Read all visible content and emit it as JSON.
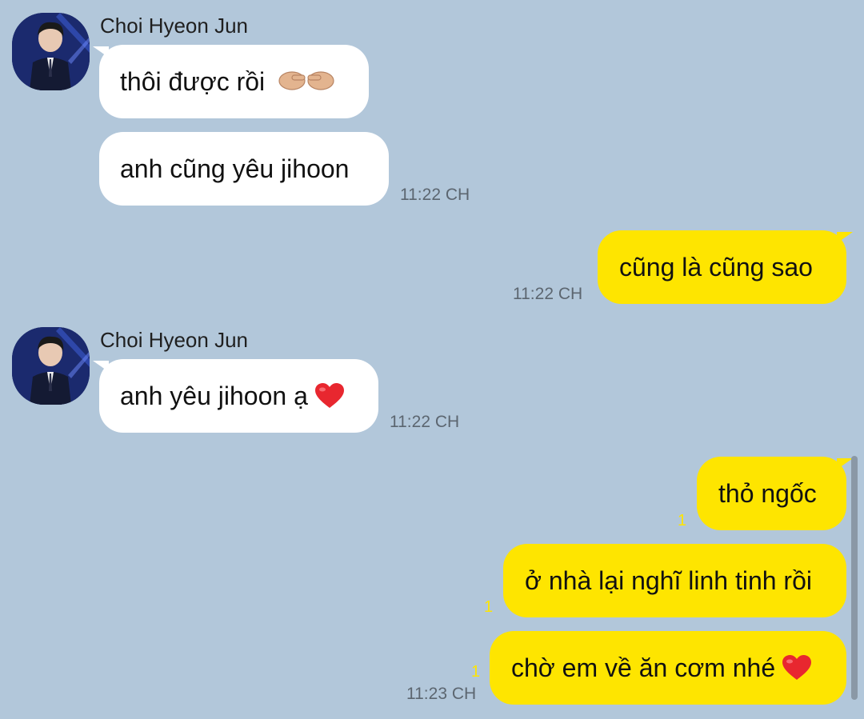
{
  "messages": {
    "m1": {
      "sender": "Choi Hyeon Jun",
      "text": "thôi được rồi",
      "emoji": "pointing-hands"
    },
    "m2": {
      "text": "anh cũng yêu jihoon",
      "time": "11:22 CH"
    },
    "m3": {
      "text": "cũng là cũng sao",
      "time": "11:22 CH"
    },
    "m4": {
      "sender": "Choi Hyeon Jun",
      "text": "anh yêu jihoon ạ",
      "emoji": "red-heart",
      "time": "11:22 CH"
    },
    "m5": {
      "text": "thỏ ngốc",
      "unread": "1"
    },
    "m6": {
      "text": "ở nhà lại nghĩ linh tinh rồi",
      "unread": "1"
    },
    "m7": {
      "text": "chờ em về ăn cơm nhé",
      "emoji": "red-heart",
      "unread": "1",
      "time": "11:23 CH"
    }
  },
  "colors": {
    "background": "#b2c7da",
    "incoming_bubble": "#ffffff",
    "outgoing_bubble": "#fee500",
    "timestamp": "#5c6670",
    "unread_count": "#fee500"
  }
}
